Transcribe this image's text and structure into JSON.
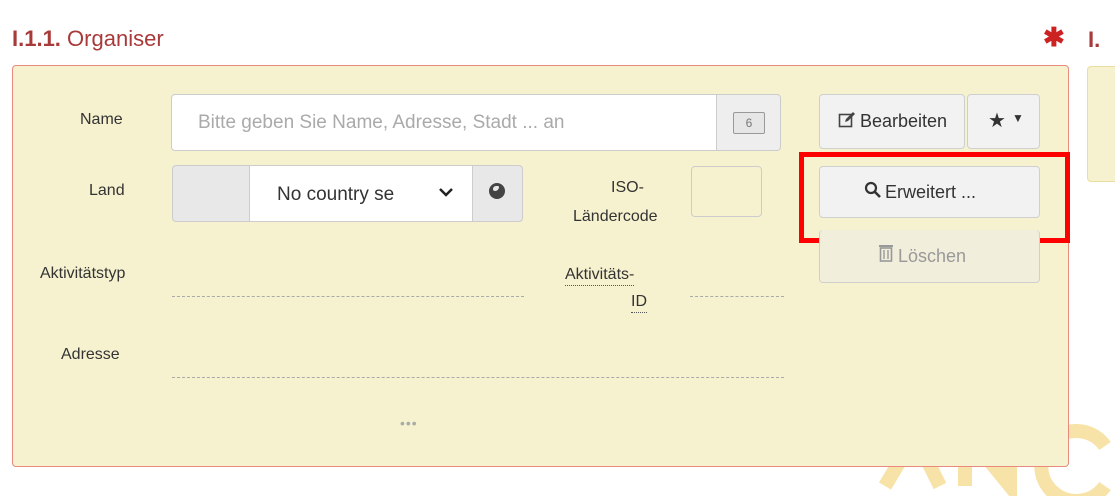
{
  "section": {
    "number": "I.1.1.",
    "title": "Organiser",
    "next_label": "I."
  },
  "labels": {
    "name": "Name",
    "land": "Land",
    "iso_line1": "ISO-",
    "iso_line2": "Ländercode",
    "activity_type": "Aktivitätstyp",
    "activity_id_line1": "Aktivitäts-",
    "activity_id_line2": "ID",
    "address": "Adresse"
  },
  "name_input": {
    "placeholder": "Bitte geben Sie Name, Adresse, Stadt ... an",
    "min_chars_badge": "6"
  },
  "country_select": {
    "selected": "No country se"
  },
  "buttons": {
    "edit": "Bearbeiten",
    "favorites_icon": "star-icon",
    "advanced": "Erweitert ...",
    "delete": "Löschen"
  },
  "more": "•••",
  "colors": {
    "panel_background": "#f6f2cf",
    "panel_border": "#e98a7e",
    "title": "#a83a3a",
    "highlight": "#ff0000"
  }
}
